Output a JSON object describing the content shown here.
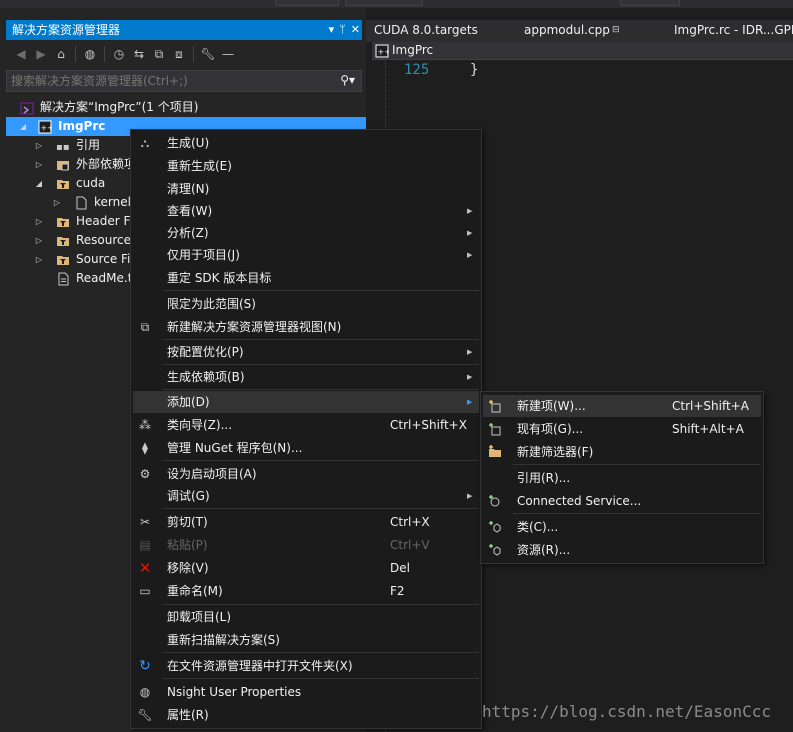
{
  "panel": {
    "title": "解决方案资源管理器",
    "title_buttons": [
      "▾",
      "ᛘ",
      "✕"
    ],
    "search_placeholder": "搜索解决方案资源管理器(Ctrl+;)"
  },
  "tree": {
    "solution": "解决方案“ImgPrc”(1 个项目)",
    "project": "ImgPrc",
    "items": [
      {
        "label": "引用"
      },
      {
        "label": "外部依赖项"
      },
      {
        "label": "cuda"
      },
      {
        "label": "kernel"
      },
      {
        "label": "Header F"
      },
      {
        "label": "Resource"
      },
      {
        "label": "Source Fi"
      },
      {
        "label": "ReadMe.t"
      }
    ]
  },
  "editor": {
    "tabs": [
      "CUDA 8.0.targets",
      "appmodul.cpp",
      "ImgPrc.rc - IDR...GPR"
    ],
    "nav_label": "ImgPrc",
    "line_number": "125",
    "code": "}"
  },
  "context_menu": {
    "items": [
      {
        "label": "生成(U)",
        "shortcut": "",
        "icon": "build-icon",
        "submenu": false
      },
      {
        "label": "重新生成(E)",
        "shortcut": "",
        "icon": "",
        "submenu": false
      },
      {
        "label": "清理(N)",
        "shortcut": "",
        "icon": "",
        "submenu": false
      },
      {
        "label": "查看(W)",
        "shortcut": "",
        "icon": "",
        "submenu": true
      },
      {
        "label": "分析(Z)",
        "shortcut": "",
        "icon": "",
        "submenu": true
      },
      {
        "label": "仅用于项目(J)",
        "shortcut": "",
        "icon": "",
        "submenu": true
      },
      {
        "label": "重定 SDK 版本目标",
        "shortcut": "",
        "icon": "",
        "submenu": false
      },
      {
        "label": "限定为此范围(S)",
        "shortcut": "",
        "icon": "",
        "submenu": false
      },
      {
        "label": "新建解决方案资源管理器视图(N)",
        "shortcut": "",
        "icon": "new-view-icon",
        "submenu": false
      },
      {
        "label": "按配置优化(P)",
        "shortcut": "",
        "icon": "",
        "submenu": true
      },
      {
        "label": "生成依赖项(B)",
        "shortcut": "",
        "icon": "",
        "submenu": true
      },
      {
        "label": "添加(D)",
        "shortcut": "",
        "icon": "",
        "submenu": true
      },
      {
        "label": "类向导(Z)...",
        "shortcut": "Ctrl+Shift+X",
        "icon": "class-wizard-icon",
        "submenu": false
      },
      {
        "label": "管理 NuGet 程序包(N)...",
        "shortcut": "",
        "icon": "nuget-icon",
        "submenu": false
      },
      {
        "label": "设为启动项目(A)",
        "shortcut": "",
        "icon": "gear-icon",
        "submenu": false
      },
      {
        "label": "调试(G)",
        "shortcut": "",
        "icon": "",
        "submenu": true
      },
      {
        "label": "剪切(T)",
        "shortcut": "Ctrl+X",
        "icon": "scissors-icon",
        "submenu": false
      },
      {
        "label": "粘贴(P)",
        "shortcut": "Ctrl+V",
        "icon": "paste-icon",
        "submenu": false,
        "disabled": true
      },
      {
        "label": "移除(V)",
        "shortcut": "Del",
        "icon": "remove-icon",
        "submenu": false
      },
      {
        "label": "重命名(M)",
        "shortcut": "F2",
        "icon": "rename-icon",
        "submenu": false
      },
      {
        "label": "卸载项目(L)",
        "shortcut": "",
        "icon": "",
        "submenu": false
      },
      {
        "label": "重新扫描解决方案(S)",
        "shortcut": "",
        "icon": "",
        "submenu": false
      },
      {
        "label": "在文件资源管理器中打开文件夹(X)",
        "shortcut": "",
        "icon": "open-folder-icon",
        "submenu": false
      },
      {
        "label": "Nsight User Properties",
        "shortcut": "",
        "icon": "nsight-icon",
        "submenu": false
      },
      {
        "label": "属性(R)",
        "shortcut": "",
        "icon": "wrench-icon",
        "submenu": false
      }
    ]
  },
  "submenu": {
    "items": [
      {
        "label": "新建项(W)...",
        "shortcut": "Ctrl+Shift+A",
        "icon": "new-item-icon"
      },
      {
        "label": "现有项(G)...",
        "shortcut": "Shift+Alt+A",
        "icon": "existing-item-icon"
      },
      {
        "label": "新建筛选器(F)",
        "shortcut": "",
        "icon": "new-filter-icon"
      },
      {
        "label": "引用(R)...",
        "shortcut": "",
        "icon": ""
      },
      {
        "label": "Connected Service...",
        "shortcut": "",
        "icon": "connected-service-icon"
      },
      {
        "label": "类(C)...",
        "shortcut": "",
        "icon": "class-icon"
      },
      {
        "label": "资源(R)...",
        "shortcut": "",
        "icon": "resource-icon"
      }
    ]
  },
  "watermark": "https://blog.csdn.net/EasonCcc",
  "colors": {
    "accent": "#007acc",
    "selection": "#3399ff",
    "menu_bg": "#1b1b1c",
    "menu_highlight": "#333334",
    "line_number": "#2b91af"
  }
}
